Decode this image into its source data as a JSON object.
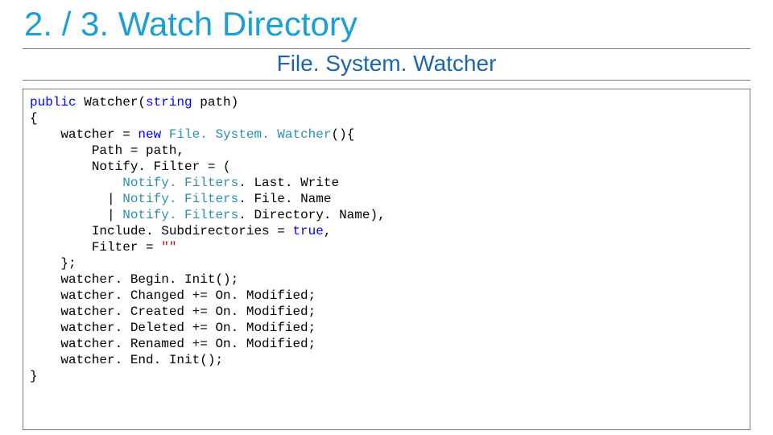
{
  "title": "2. / 3. Watch Directory",
  "subtitle": "File. System. Watcher",
  "code": {
    "l01_kw_public": "public",
    "l01_space1": " Watcher(",
    "l01_kw_string": "string",
    "l01_rest": " path)",
    "l02": "{",
    "l03_a": "    watcher = ",
    "l03_kw_new": "new",
    "l03_b": " ",
    "l03_typ": "File. System. Watcher",
    "l03_c": "(){",
    "l04": "        Path = path,",
    "l05": "        Notify. Filter = (",
    "l06_a": "            ",
    "l06_typ": "Notify. Filters",
    "l06_b": ". Last. Write",
    "l07_a": "          | ",
    "l07_typ": "Notify. Filters",
    "l07_b": ". File. Name",
    "l08_a": "          | ",
    "l08_typ": "Notify. Filters",
    "l08_b": ". Directory. Name),",
    "l09_a": "        Include. Subdirectories = ",
    "l09_kw_true": "true",
    "l09_b": ",",
    "l10_a": "        Filter = ",
    "l10_str": "\"\"",
    "l11": "    };",
    "l12": "    watcher. Begin. Init();",
    "l13": "    watcher. Changed += On. Modified;",
    "l14": "    watcher. Created += On. Modified;",
    "l15": "    watcher. Deleted += On. Modified;",
    "l16": "    watcher. Renamed += On. Modified;",
    "l17": "    watcher. End. Init();",
    "l18": "}"
  }
}
